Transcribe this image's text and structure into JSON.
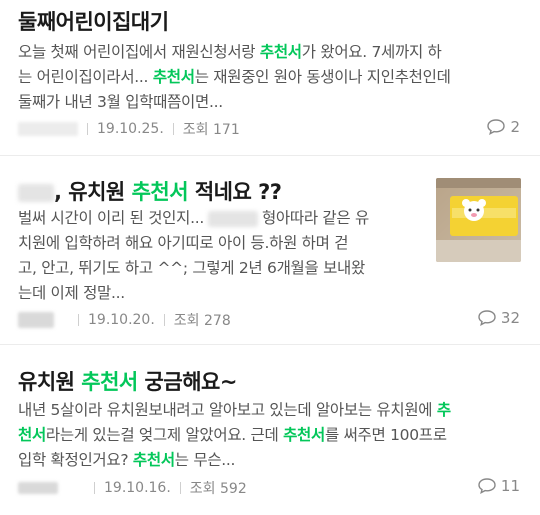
{
  "posts": [
    {
      "title": "둘째어린이집대기",
      "snippet_line1_a": "오늘 첫째 어린이집에서 재원신청서랑 ",
      "snippet_line1_hl": "추천서",
      "snippet_line1_b": "가 왔어요. 7세까지 하",
      "snippet_line2_a": "는 어린이집이라서... ",
      "snippet_line2_hl": "추천서",
      "snippet_line2_b": "는 재원중인 원아 동생이나 지인추천인데",
      "snippet_line3": "둘째가 내년 3월 입학때쯤이면...",
      "date": "19.10.25.",
      "views": "조회 171",
      "comments": "2"
    },
    {
      "title_a": ", 유치원 ",
      "title_hl": "추천서",
      "title_b": " 적네요 ??",
      "snippet_line1_a": "벌써 시간이 이리 된 것인지...",
      "snippet_line1_b": "형아따라 같은 유",
      "snippet_line2": "치원에 입학하려 해요 아기띠로 아이 등.하원 하며 걷",
      "snippet_line3": "고, 안고, 뛰기도 하고 ^^; 그렇게 2년 6개월을 보내왔",
      "snippet_line4": "는데 이제 정말...",
      "date": "19.10.20.",
      "views": "조회 278",
      "comments": "32"
    },
    {
      "title_a": "유치원 ",
      "title_hl": "추천서",
      "title_b": " 궁금해요~",
      "snippet_line1_a": "내년 5살이라 유치원보내려고 알아보고 있는데 알아보는 유치원에 ",
      "snippet_line1_hl": "추",
      "snippet_line2_hl": "천서",
      "snippet_line2_a": "라는게 있는걸 엊그제 알았어요. 근데 ",
      "snippet_line2_hl2": "추천서",
      "snippet_line2_b": "를 써주면 100프로",
      "snippet_line3_a": "입학 확정인거요? ",
      "snippet_line3_hl": "추천서",
      "snippet_line3_b": "는 무슨...",
      "date": "19.10.16.",
      "views": "조회 592",
      "comments": "11"
    }
  ],
  "colors": {
    "highlight": "#03c75a",
    "meta": "#888888"
  },
  "icons": {
    "comment": "speech-bubble-icon"
  }
}
